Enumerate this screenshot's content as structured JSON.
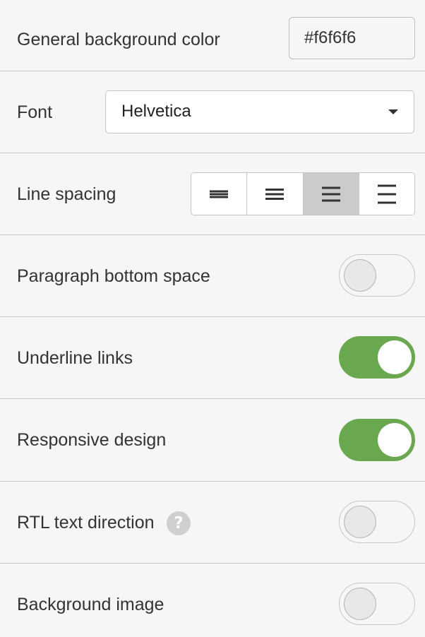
{
  "settings": {
    "background_color": {
      "label": "General background color",
      "value": "#f6f6f6"
    },
    "font": {
      "label": "Font",
      "value": "Helvetica"
    },
    "line_spacing": {
      "label": "Line spacing",
      "options": [
        "tight",
        "compact",
        "normal",
        "loose"
      ],
      "selected": "normal"
    },
    "paragraph_bottom_space": {
      "label": "Paragraph bottom space",
      "enabled": false
    },
    "underline_links": {
      "label": "Underline links",
      "enabled": true
    },
    "responsive_design": {
      "label": "Responsive design",
      "enabled": true
    },
    "rtl_text_direction": {
      "label": "RTL text direction",
      "help": "?",
      "enabled": false
    },
    "background_image": {
      "label": "Background image",
      "enabled": false
    }
  },
  "colors": {
    "panel_bg": "#f6f6f6",
    "divider": "#c8c8c8",
    "toggle_on": "#6aa84f",
    "segment_active": "#cbcbcb"
  }
}
